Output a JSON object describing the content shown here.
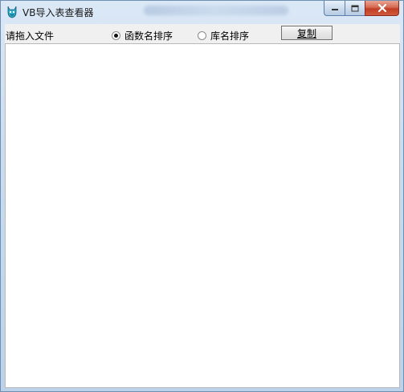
{
  "window": {
    "title": "VB导入表查看器",
    "app_icon": "cat-app-icon"
  },
  "titlebar_controls": {
    "minimize_icon": "minimize-icon",
    "maximize_icon": "maximize-icon",
    "close_icon": "close-icon"
  },
  "toolbar": {
    "drop_label": "请拖入文件",
    "sort_options": [
      {
        "label": "函数名排序",
        "selected": true
      },
      {
        "label": "库名排序",
        "selected": false
      }
    ],
    "copy_label": "复制"
  },
  "colors": {
    "title_gradient_top": "#dbe8f6",
    "title_gradient_bottom": "#bcd2ea",
    "close_button_red": "#c13e25",
    "panel_background": "#f0f0f0",
    "content_background": "#ffffff"
  }
}
